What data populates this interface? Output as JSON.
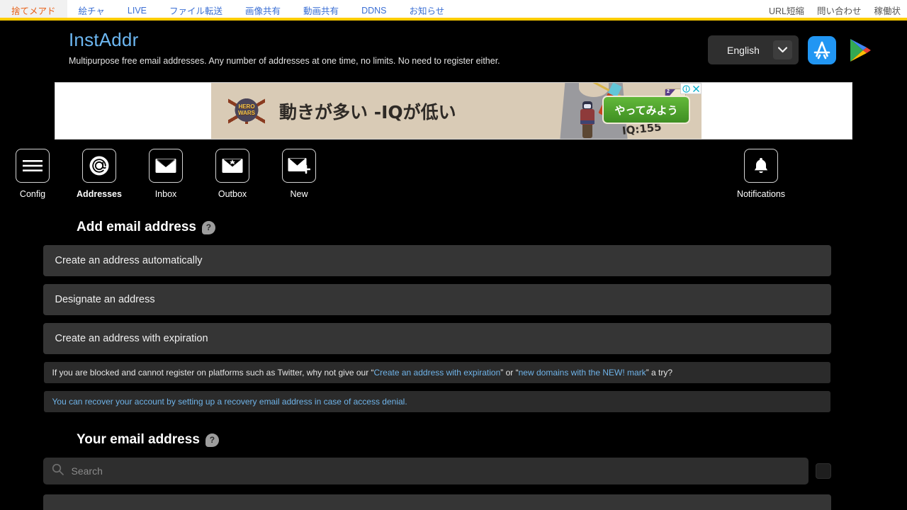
{
  "topbar": {
    "left_items": [
      {
        "label": "捨てメアド",
        "active": true
      },
      {
        "label": "絵チャ",
        "active": false
      },
      {
        "label": "LIVE",
        "active": false
      },
      {
        "label": "ファイル転送",
        "active": false
      },
      {
        "label": "画像共有",
        "active": false
      },
      {
        "label": "動画共有",
        "active": false
      },
      {
        "label": "DDNS",
        "active": false
      },
      {
        "label": "お知らせ",
        "active": false
      }
    ],
    "right_items": [
      {
        "label": "URL短縮"
      },
      {
        "label": "問い合わせ"
      },
      {
        "label": "稼働状"
      }
    ],
    "accent": "#ffcc00",
    "link_color": "#3b6fd4",
    "active_color": "#e8621a"
  },
  "header": {
    "logo": "InstAddr",
    "logo_color": "#6cb6f0",
    "tagline": "Multipurpose free email addresses. Any number of addresses at one time, no limits. No need to register either.",
    "language": "English",
    "chevron_icon": "chevron-down-icon",
    "appstore_icon": "app-store-icon",
    "googleplay_icon": "google-play-icon"
  },
  "ad": {
    "brand": "HERO\nWARS",
    "brand_line1": "HERO",
    "brand_line2": "WARS",
    "headline": "動きが多い -IQが低い",
    "iq_text": "IQ:155",
    "card_number": "2",
    "cta": "やってみよう",
    "info_icon": "adchoices-info-icon",
    "close_icon": "close-icon"
  },
  "iconnav": {
    "items": [
      {
        "label": "Config",
        "icon": "hamburger-menu-icon",
        "active": false
      },
      {
        "label": "Addresses",
        "icon": "at-sign-icon",
        "active": true
      },
      {
        "label": "Inbox",
        "icon": "envelope-inbox-icon",
        "active": false
      },
      {
        "label": "Outbox",
        "icon": "envelope-outbox-icon",
        "active": false
      },
      {
        "label": "New",
        "icon": "envelope-plus-icon",
        "active": false
      }
    ],
    "notifications": {
      "label": "Notifications",
      "icon": "bell-icon"
    }
  },
  "main": {
    "add_section": {
      "title": "Add email address",
      "help_icon": "help-question-icon",
      "actions": [
        "Create an address automatically",
        "Designate an address",
        "Create an address with expiration"
      ],
      "notice": {
        "part1": "If you are blocked and cannot register on platforms such as Twitter, why not give our “",
        "link1": "Create an address with expiration",
        "part2": "” or “",
        "link2": "new domains with the NEW! mark",
        "part3": "” a try?"
      },
      "recovery_link": "You can recover your account by setting up a recovery email address in case of access denial."
    },
    "your_section": {
      "title": "Your email address",
      "help_icon": "help-question-icon",
      "search_placeholder": "Search",
      "search_value": "",
      "search_icon": "search-icon",
      "extra_button_icon": "options-button"
    }
  }
}
